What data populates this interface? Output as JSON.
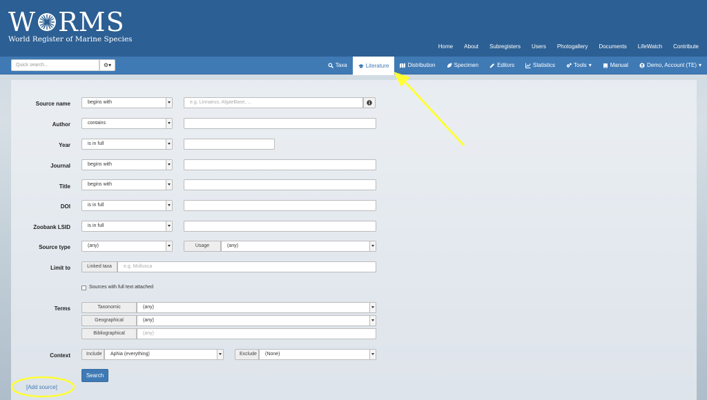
{
  "brand": {
    "word_left": "W",
    "word_right": "RMS",
    "subtitle": "World Register of Marine Species"
  },
  "top_nav": [
    "Home",
    "About",
    "Subregisters",
    "Users",
    "Photogallery",
    "Documents",
    "LifeWatch",
    "Contribute"
  ],
  "quick_search": {
    "placeholder": "Quick search..."
  },
  "sub_nav": {
    "taxa": "Taxa",
    "literature": "Literature",
    "distribution": "Distribution",
    "specimen": "Specimen",
    "editors": "Editors",
    "statistics": "Statistics",
    "tools": "Tools",
    "manual": "Manual",
    "account": "Demo, Account (TE)"
  },
  "form": {
    "source_name": {
      "label": "Source name",
      "op": "begins with",
      "placeholder": "e.g. Linnaeus, AlgaeBase, ..."
    },
    "author": {
      "label": "Author",
      "op": "contains"
    },
    "year": {
      "label": "Year",
      "op": "is in full"
    },
    "journal": {
      "label": "Journal",
      "op": "begins with"
    },
    "title": {
      "label": "Title",
      "op": "begins with"
    },
    "doi": {
      "label": "DOI",
      "op": "is in full"
    },
    "zoobank": {
      "label": "Zoobank LSID",
      "op": "is in full"
    },
    "source_type": {
      "label": "Source type",
      "value": "(any)",
      "usage_label": "Usage",
      "usage_value": "(any)"
    },
    "limit_to": {
      "label": "Limit to",
      "addon": "Linked taxa",
      "placeholder": "e.g. Mollusca"
    },
    "fulltext": {
      "label": "Sources with full text attached"
    },
    "terms": {
      "label": "Terms",
      "taxonomic_label": "Taxonomic",
      "taxonomic_value": "(any)",
      "geographical_label": "Geographical",
      "geographical_value": "(any)",
      "bibliographical_label": "Bibliographical",
      "bibliographical_placeholder": "(any)"
    },
    "context": {
      "label": "Context",
      "include_label": "Include",
      "include_value": "Aphia (everything)",
      "exclude_label": "Exclude",
      "exclude_value": "(None)"
    },
    "search_label": "Search",
    "add_source": "[Add source]"
  },
  "colors": {
    "header": "#2c5f93",
    "navbar": "#3f7ab5",
    "highlight": "#ffff33"
  }
}
